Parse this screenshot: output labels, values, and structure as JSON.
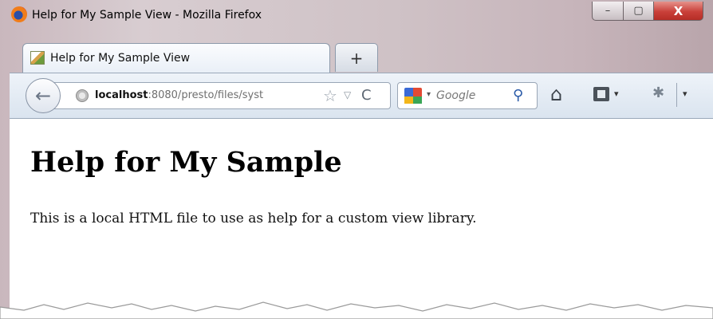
{
  "window": {
    "title": "Help for My Sample View - Mozilla Firefox",
    "controls": {
      "minimize": "–",
      "maximize": "▢",
      "close": "X"
    }
  },
  "tabs": {
    "active_label": "Help for My Sample View",
    "new_tab_label": "+"
  },
  "navbar": {
    "back_glyph": "←",
    "url_host": "localhost",
    "url_rest": ":8080/presto/files/syst",
    "star_glyph": "☆",
    "url_dropdown_glyph": "▽",
    "reload_glyph": "C",
    "search_engine_dropdown_glyph": "▾",
    "search_placeholder": "Google",
    "search_glyph": "⚲",
    "home_glyph": "⌂",
    "bookmarks_dropdown_glyph": "▾",
    "addon_glyph": "✱",
    "menu_dropdown_glyph": "▾"
  },
  "page": {
    "heading": "Help for My Sample",
    "paragraph": "This is a local HTML file to use as help for a custom view library."
  },
  "colors": {
    "close_button": "#c9403a",
    "toolbar_bg": "#dae4ef",
    "page_bg": "#ffffff"
  }
}
